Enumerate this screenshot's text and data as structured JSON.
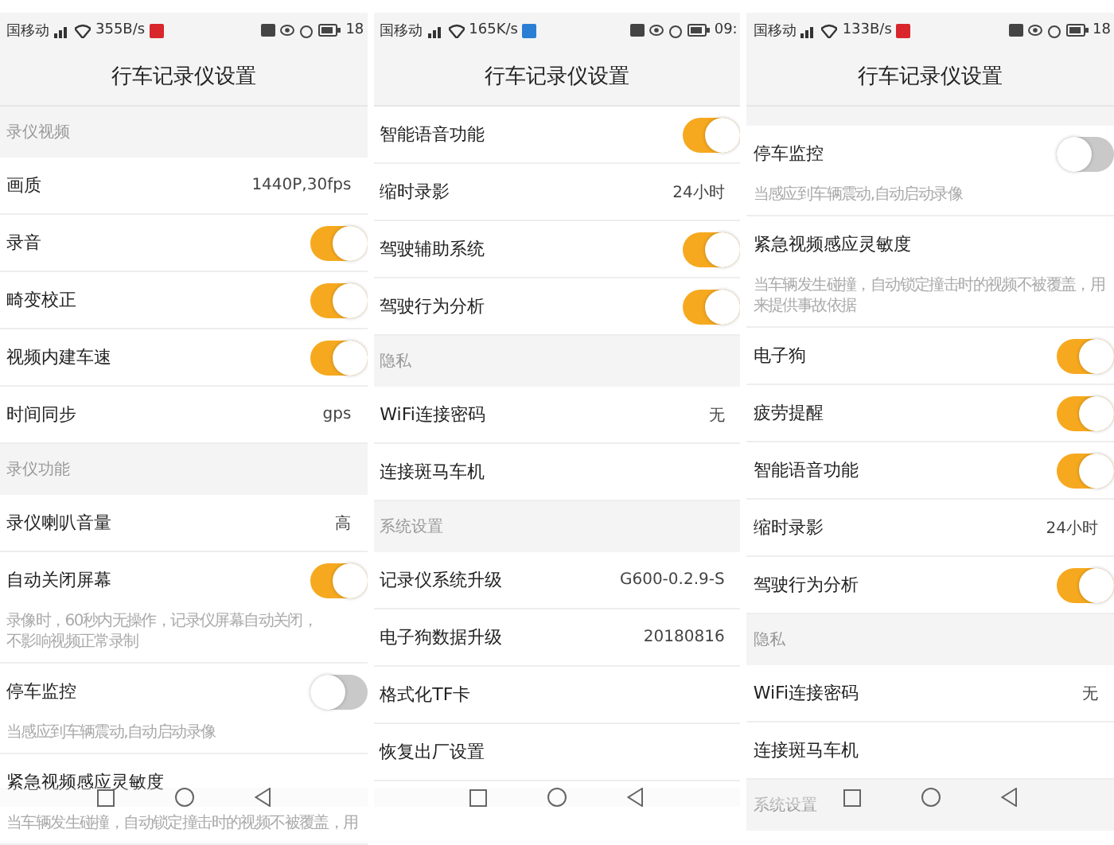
{
  "screens": [
    {
      "status_bar": {
        "carrier": "国移动",
        "speed": "355B/s",
        "badge": {
          "color": "#d9262c"
        },
        "time": "18"
      },
      "title": "行车记录仪设置",
      "rows": [
        {
          "kind": "header",
          "label": "录仪视频"
        },
        {
          "kind": "value",
          "label": "画质",
          "value": "1440P,30fps"
        },
        {
          "kind": "toggle",
          "label": "录音",
          "on": true
        },
        {
          "kind": "toggle",
          "label": "畸变校正",
          "on": true
        },
        {
          "kind": "toggle",
          "label": "视频内建车速",
          "on": true
        },
        {
          "kind": "value",
          "label": "时间同步",
          "value": "gps"
        },
        {
          "kind": "header",
          "label": "录仪功能"
        },
        {
          "kind": "value",
          "label": "录仪喇叭音量",
          "value": "高"
        },
        {
          "kind": "toggle",
          "label": "自动关闭屏幕",
          "on": true,
          "description": "录像时，60秒内无操作，记录仪屏幕自动关闭，不影响视频正常录制"
        },
        {
          "kind": "toggle",
          "label": "停车监控",
          "on": false,
          "description": "当感应到车辆震动,自动启动录像"
        },
        {
          "kind": "plain",
          "label": "紧急视频感应灵敏度",
          "description": "当车辆发生碰撞，自动锁定撞击时的视频不被覆盖，用"
        }
      ]
    },
    {
      "status_bar": {
        "carrier": "国移动",
        "speed": "165K/s",
        "badge": {
          "color": "#2a7fd4"
        },
        "time": "09:"
      },
      "title": "行车记录仪设置",
      "rows": [
        {
          "kind": "toggle",
          "label": "智能语音功能",
          "on": true
        },
        {
          "kind": "value",
          "label": "缩时录影",
          "value": "24小时"
        },
        {
          "kind": "toggle",
          "label": "驾驶辅助系统",
          "on": true
        },
        {
          "kind": "toggle",
          "label": "驾驶行为分析",
          "on": true
        },
        {
          "kind": "header",
          "label": "隐私"
        },
        {
          "kind": "value",
          "label": "WiFi连接密码",
          "value": "无"
        },
        {
          "kind": "plain",
          "label": "连接斑马车机"
        },
        {
          "kind": "header",
          "label": "系统设置"
        },
        {
          "kind": "value",
          "label": "记录仪系统升级",
          "value": "G600-0.2.9-S"
        },
        {
          "kind": "value",
          "label": "电子狗数据升级",
          "value": "20180816"
        },
        {
          "kind": "plain",
          "label": "格式化TF卡"
        },
        {
          "kind": "plain",
          "label": "恢复出厂设置"
        }
      ]
    },
    {
      "status_bar": {
        "carrier": "国移动",
        "speed": "133B/s",
        "badge": {
          "color": "#d9262c"
        },
        "time": "18"
      },
      "title": "行车记录仪设置",
      "rows": [
        {
          "kind": "spacer"
        },
        {
          "kind": "toggle",
          "label": "停车监控",
          "on": false,
          "description": "当感应到车辆震动,自动启动录像"
        },
        {
          "kind": "plain",
          "label": "紧急视频感应灵敏度",
          "description": "当车辆发生碰撞，自动锁定撞击时的视频不被覆盖，用来提供事故依据"
        },
        {
          "kind": "toggle",
          "label": "电子狗",
          "on": true
        },
        {
          "kind": "toggle",
          "label": "疲劳提醒",
          "on": true
        },
        {
          "kind": "toggle",
          "label": "智能语音功能",
          "on": true
        },
        {
          "kind": "value",
          "label": "缩时录影",
          "value": "24小时"
        },
        {
          "kind": "toggle",
          "label": "驾驶行为分析",
          "on": true
        },
        {
          "kind": "header",
          "label": "隐私"
        },
        {
          "kind": "value",
          "label": "WiFi连接密码",
          "value": "无"
        },
        {
          "kind": "plain",
          "label": "连接斑马车机"
        },
        {
          "kind": "header",
          "label": "系统设置"
        }
      ]
    }
  ]
}
